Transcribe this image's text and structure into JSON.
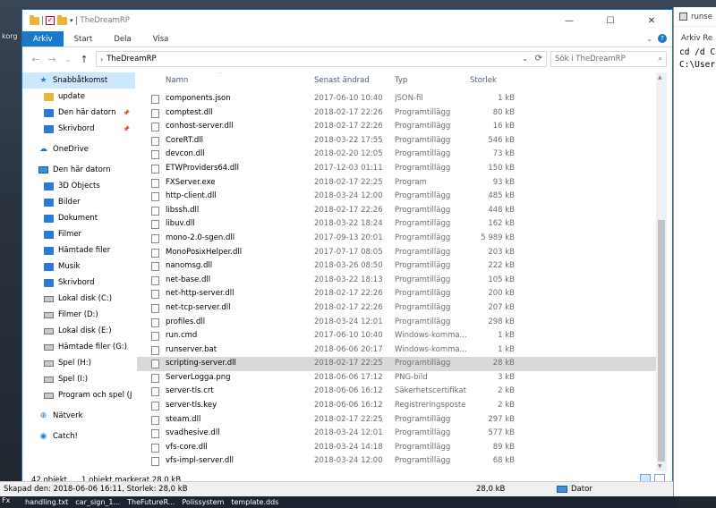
{
  "desktop": {
    "left_label": "korg",
    "left_label2": "Fx",
    "bottom_items": [
      "handling.txt",
      "car_sign_1...",
      "TheFutureR...",
      "Polissystem",
      "template.dds"
    ]
  },
  "console": {
    "title": "runse",
    "menu": "Arkiv Re",
    "lines": [
      "cd /d C",
      "C:\\User"
    ]
  },
  "explorer": {
    "title": "TheDreamRP",
    "controls": {
      "minimize": "—",
      "maximize": "☐",
      "close": "✕"
    },
    "ribbon": {
      "file": "Arkiv",
      "tabs": [
        "Start",
        "Dela",
        "Visa"
      ],
      "expand": "⌄",
      "help": "?"
    },
    "address": {
      "back": "←",
      "forward": "→",
      "recent": "⌄",
      "up": "↑",
      "separator": "›",
      "crumb": "TheDreamRP",
      "dropdown": "⌄",
      "refresh": "⟳"
    },
    "search": {
      "placeholder": "Sök i TheDreamRP",
      "icon": "⌕"
    },
    "nav": [
      {
        "label": "Snabbåtkomst",
        "icon": "star",
        "selected": true,
        "pinned": false
      },
      {
        "label": "update",
        "icon": "folder",
        "pinned": false
      },
      {
        "label": "Den här datorn",
        "icon": "blue-folder",
        "pinned": true
      },
      {
        "label": "Skrivbord",
        "icon": "blue-folder",
        "pinned": true
      },
      {
        "gap": true
      },
      {
        "label": "OneDrive",
        "icon": "cloud"
      },
      {
        "gap": true
      },
      {
        "label": "Den här datorn",
        "icon": "pc"
      },
      {
        "label": "3D Objects",
        "icon": "blue-folder"
      },
      {
        "label": "Bilder",
        "icon": "blue-folder"
      },
      {
        "label": "Dokument",
        "icon": "blue-folder"
      },
      {
        "label": "Filmer",
        "icon": "blue-folder"
      },
      {
        "label": "Hämtade filer",
        "icon": "blue-folder"
      },
      {
        "label": "Musik",
        "icon": "blue-folder"
      },
      {
        "label": "Skrivbord",
        "icon": "blue-folder"
      },
      {
        "label": "Lokal disk (C:)",
        "icon": "drive"
      },
      {
        "label": "Filmer (D:)",
        "icon": "drive"
      },
      {
        "label": "Lokal disk (E:)",
        "icon": "drive"
      },
      {
        "label": "Hämtade filer (G:)",
        "icon": "drive"
      },
      {
        "label": "Spel (H:)",
        "icon": "drive"
      },
      {
        "label": "Spel (I:)",
        "icon": "drive"
      },
      {
        "label": "Program och spel (J",
        "icon": "drive"
      },
      {
        "gap": true
      },
      {
        "label": "Nätverk",
        "icon": "network"
      },
      {
        "gap": true
      },
      {
        "label": "Catch!",
        "icon": "catch"
      }
    ],
    "columns": {
      "name": "Namn",
      "date": "Senast ändrad",
      "type": "Typ",
      "size": "Storlek",
      "sort_indicator": "^"
    },
    "files": [
      {
        "name": "components.json",
        "date": "2017-06-10 10:40",
        "type": "JSON-fil",
        "size": "1 kB"
      },
      {
        "name": "comptest.dll",
        "date": "2018-02-17 22:26",
        "type": "Programtillägg",
        "size": "80 kB"
      },
      {
        "name": "conhost-server.dll",
        "date": "2018-02-17 22:26",
        "type": "Programtillägg",
        "size": "16 kB"
      },
      {
        "name": "CoreRT.dll",
        "date": "2018-03-22 17:55",
        "type": "Programtillägg",
        "size": "546 kB"
      },
      {
        "name": "devcon.dll",
        "date": "2018-02-20 12:05",
        "type": "Programtillägg",
        "size": "73 kB"
      },
      {
        "name": "ETWProviders64.dll",
        "date": "2017-12-03 01:11",
        "type": "Programtillägg",
        "size": "150 kB"
      },
      {
        "name": "FXServer.exe",
        "date": "2018-02-17 22:25",
        "type": "Program",
        "size": "93 kB"
      },
      {
        "name": "http-client.dll",
        "date": "2018-03-24 12:00",
        "type": "Programtillägg",
        "size": "485 kB"
      },
      {
        "name": "libssh.dll",
        "date": "2018-02-17 22:26",
        "type": "Programtillägg",
        "size": "448 kB"
      },
      {
        "name": "libuv.dll",
        "date": "2018-03-22 18:24",
        "type": "Programtillägg",
        "size": "162 kB"
      },
      {
        "name": "mono-2.0-sgen.dll",
        "date": "2017-09-13 20:01",
        "type": "Programtillägg",
        "size": "5 989 kB"
      },
      {
        "name": "MonoPosixHelper.dll",
        "date": "2017-07-17 08:05",
        "type": "Programtillägg",
        "size": "203 kB"
      },
      {
        "name": "nanomsg.dll",
        "date": "2018-03-26 08:50",
        "type": "Programtillägg",
        "size": "222 kB"
      },
      {
        "name": "net-base.dll",
        "date": "2018-03-22 18:13",
        "type": "Programtillägg",
        "size": "105 kB"
      },
      {
        "name": "net-http-server.dll",
        "date": "2018-02-17 22:26",
        "type": "Programtillägg",
        "size": "200 kB"
      },
      {
        "name": "net-tcp-server.dll",
        "date": "2018-02-17 22:26",
        "type": "Programtillägg",
        "size": "207 kB"
      },
      {
        "name": "profiles.dll",
        "date": "2018-03-24 12:01",
        "type": "Programtillägg",
        "size": "298 kB"
      },
      {
        "name": "run.cmd",
        "date": "2017-06-10 10:40",
        "type": "Windows-komma...",
        "size": "1 kB"
      },
      {
        "name": "runserver.bat",
        "date": "2018-06-06 20:17",
        "type": "Windows-komma...",
        "size": "1 kB"
      },
      {
        "name": "scripting-server.dll",
        "date": "2018-02-17 22:25",
        "type": "Programtillägg",
        "size": "28 kB",
        "selected": true
      },
      {
        "name": "ServerLogga.png",
        "date": "2018-06-06 17:12",
        "type": "PNG-bild",
        "size": "3 kB"
      },
      {
        "name": "server-tls.crt",
        "date": "2018-06-06 16:12",
        "type": "Säkerhetscertifikat",
        "size": "2 kB"
      },
      {
        "name": "server-tls.key",
        "date": "2018-06-06 16:12",
        "type": "Registreringsposter",
        "size": "2 kB"
      },
      {
        "name": "steam.dll",
        "date": "2018-02-17 22:25",
        "type": "Programtillägg",
        "size": "297 kB"
      },
      {
        "name": "svadhesive.dll",
        "date": "2018-03-24 12:01",
        "type": "Programtillägg",
        "size": "577 kB"
      },
      {
        "name": "vfs-core.dll",
        "date": "2018-03-24 14:18",
        "type": "Programtillägg",
        "size": "89 kB"
      },
      {
        "name": "vfs-impl-server.dll",
        "date": "2018-03-24 12:00",
        "type": "Programtillägg",
        "size": "68 kB"
      }
    ],
    "status": {
      "count": "42 objekt",
      "selection": "1 objekt markerat  28,0 kB"
    },
    "info": {
      "left": "Skapad den: 2018-06-06 16:11, Storlek: 28,0 kB",
      "size": "28,0 kB",
      "location": "Dator"
    },
    "colors": {
      "accent": "#1979ca",
      "selection": "#cce8ff",
      "row_selected": "#d9d9d9"
    }
  }
}
